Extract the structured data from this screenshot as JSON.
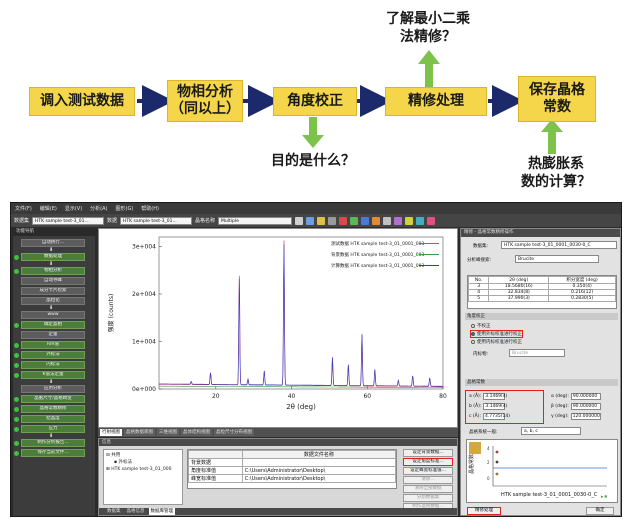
{
  "flowchart": {
    "steps": [
      "调入测试数据",
      "物相分析\n（同以上）",
      "角度校正",
      "精修处理",
      "保存晶格\n常数"
    ],
    "question_top": "了解最小二乘\n法精修？",
    "question_bottom": "目的是什么？",
    "question_right": "热膨胀系\n数的计算？"
  },
  "app": {
    "menu": [
      "文件(F)",
      "编辑(E)",
      "显示(V)",
      "分析(A)",
      "图形(G)",
      "帮助(H)"
    ],
    "toolbar": {
      "dataset_label": "数据集",
      "dataset_value": "HTK sample test-3_01...",
      "data_label": "数据",
      "data_value": "HTK sample test-3_01...",
      "sample_label": "晶格名称",
      "sample_value": "Multiple"
    },
    "left_nav": {
      "title": "功能导航",
      "steps": [
        {
          "label": "自动执行..."
        },
        {
          "label": "数据处理"
        },
        {
          "label": "物相分析"
        },
        {
          "label": "自动寻峰"
        },
        {
          "label": "成分卡片检索"
        },
        {
          "label": "晶粒化"
        },
        {
          "label": "www"
        },
        {
          "label": "确定晶相"
        },
        {
          "label": "定量"
        },
        {
          "label": "RIR值"
        },
        {
          "label": "外标法"
        },
        {
          "label": "内标法"
        },
        {
          "label": "K值法定量"
        },
        {
          "label": "应用分析"
        },
        {
          "label": "晶胞尺寸/晶格畸变"
        },
        {
          "label": "晶格常数精修"
        },
        {
          "label": "结晶度"
        },
        {
          "label": "应力"
        },
        {
          "label": "制作分析报告..."
        },
        {
          "label": "保存当前文件..."
        }
      ]
    },
    "chart_tabs": [
      "行射视图",
      "晶格数据库图",
      "三维视图",
      "晶体结构视图",
      "晶粒尺寸分布视图"
    ],
    "info_panel": {
      "title": "信息",
      "tree": [
        "共用",
        "外标法",
        "HTK sample test-3_01_000"
      ],
      "table_header": "数据文件名称",
      "rows": [
        {
          "name": "背景数据",
          "path": ""
        },
        {
          "name": "角度标准值",
          "path": "C:\\Users\\Administrator\\Desktop\\"
        },
        {
          "name": "峰宽标准值",
          "path": "C:\\Users\\Administrator\\Desktop\\"
        }
      ],
      "buttons": [
        "设定背景数据...",
        "设定角度标准...",
        "设定峰宽标准值...",
        "清除...",
        "清除全部数据",
        "分割数据集",
        "制作晶格数据..."
      ],
      "bottom_tabs": [
        "数据集",
        "晶格信息",
        "数据库管理"
      ]
    },
    "right_panel": {
      "title": "精修 - 晶格常数精修操作",
      "dataset_label": "数据集:",
      "dataset_value": "HTK sample test-3_01_0001_0030-0_C",
      "source_label": "分析峰搜索:",
      "source_value": "Brucite",
      "table_headers": [
        "No.",
        "2θ (deg)",
        "积分宽度 (deg)"
      ],
      "peaks": [
        {
          "no": "3",
          "two_theta": "18.5680(16)",
          "width": "0.350(4)"
        },
        {
          "no": "4",
          "two_theta": "32.834(8)",
          "width": "0.216(12)"
        },
        {
          "no": "5",
          "two_theta": "37.990(3)",
          "width": "0.2830(5)"
        }
      ],
      "angle_section": "角度校正",
      "radio_options": [
        "不校正",
        "使用外标校准进行校正",
        "使用内标校准进行校正"
      ],
      "internal_label": "内标物:",
      "internal_value": "Brucite",
      "cell_section": "晶格常数",
      "cell": [
        {
          "label": "a (Å):",
          "value": "3.1469(4)",
          "angle_label": "α (deg):",
          "angle_value": "90.000000"
        },
        {
          "label": "b (Å):",
          "value": "3.1469(4)",
          "angle_label": "β (deg):",
          "angle_value": "90.000000"
        },
        {
          "label": "c (Å):",
          "value": "4.7735(14)",
          "angle_label": "γ (deg):",
          "angle_value": "120.000000"
        }
      ],
      "system_label": "晶格系统一般:",
      "system_value": "a, b, c",
      "plot_caption": "HTK sample test-3_01_0001_0030-0_C",
      "refine_button": "精修处理",
      "ok_button": "确定"
    }
  },
  "chart_data": {
    "type": "line",
    "xlabel": "2θ (deg)",
    "ylabel": "强度 (counts)",
    "xlim": [
      5,
      80
    ],
    "ylim": [
      0,
      32000
    ],
    "y_ticks": [
      "0e+000",
      "1e+004",
      "2e+004",
      "3e+004"
    ],
    "x_ticks": [
      "20",
      "40",
      "60",
      "80"
    ],
    "legend": [
      "测试数据 HTK sample test-3_01_0001_0030-0_C/3a",
      "背景数据 HTK sample test-3_01_0001_0030-0_C/3a",
      "计算数据 HTK sample test-3_01_0001_0030-0_C/3a"
    ],
    "series": [
      {
        "name": "测试数据",
        "color": "#e23b6b"
      },
      {
        "name": "背景数据",
        "color": "#3c9a3c"
      },
      {
        "name": "计算数据",
        "color": "#2c3ec8"
      }
    ],
    "peaks": [
      {
        "x": 13.5,
        "y": 600
      },
      {
        "x": 18.6,
        "y": 2500
      },
      {
        "x": 26.2,
        "y": 23000
      },
      {
        "x": 28.5,
        "y": 1200
      },
      {
        "x": 32.8,
        "y": 3000
      },
      {
        "x": 38.0,
        "y": 30500
      },
      {
        "x": 50.8,
        "y": 6000
      },
      {
        "x": 55.0,
        "y": 4500
      },
      {
        "x": 58.6,
        "y": 11000
      },
      {
        "x": 62.0,
        "y": 3500
      },
      {
        "x": 68.2,
        "y": 1200
      },
      {
        "x": 72.0,
        "y": 2200
      },
      {
        "x": 76.5,
        "y": 1800
      }
    ],
    "background_level": 1000
  },
  "colors": {
    "flow_box": "#f5d64a",
    "arrow_green": "#7dc24a",
    "arrow_blue": "#1c2a6b",
    "highlight_red": "#dd2222"
  }
}
